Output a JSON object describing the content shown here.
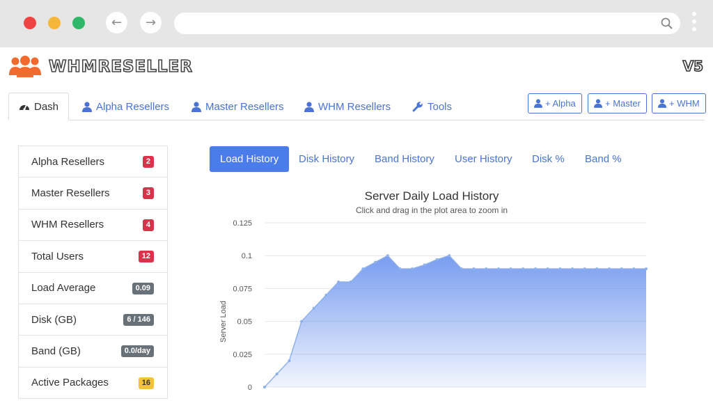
{
  "brand": {
    "name": "WHMRESELLER",
    "version": "V5"
  },
  "main_tabs": [
    {
      "label": "Dash",
      "icon": "dashboard-icon"
    },
    {
      "label": "Alpha Resellers",
      "icon": "user-icon"
    },
    {
      "label": "Master Resellers",
      "icon": "user-icon"
    },
    {
      "label": "WHM Resellers",
      "icon": "user-icon"
    },
    {
      "label": "Tools",
      "icon": "wrench-icon"
    }
  ],
  "add_buttons": [
    {
      "label": "+ Alpha"
    },
    {
      "label": "+ Master"
    },
    {
      "label": "+ WHM"
    }
  ],
  "stats": [
    {
      "label": "Alpha Resellers",
      "value": "2",
      "color": "#d9334b"
    },
    {
      "label": "Master Resellers",
      "value": "3",
      "color": "#d9334b"
    },
    {
      "label": "WHM Resellers",
      "value": "4",
      "color": "#d9334b"
    },
    {
      "label": "Total Users",
      "value": "12",
      "color": "#d9334b"
    },
    {
      "label": "Load Average",
      "value": "0.09",
      "color": "#687078"
    },
    {
      "label": "Disk (GB)",
      "value": "6 / 146",
      "color": "#687078"
    },
    {
      "label": "Band (GB)",
      "value": "0.0/day",
      "color": "#687078"
    },
    {
      "label": "Active Packages",
      "value": "16",
      "color": "#f5c33b"
    }
  ],
  "chart_tabs": [
    "Load History",
    "Disk History",
    "Band History",
    "User History",
    "Disk %",
    "Band %"
  ],
  "chart_data": {
    "type": "area",
    "title": "Server Daily Load History",
    "subtitle": "Click and drag in the plot area to zoom in",
    "ylabel": "Server Load",
    "xlabel": "",
    "ylim": [
      0,
      0.125
    ],
    "yticks": [
      "0",
      "0.025",
      "0.05",
      "0.075",
      "0.1",
      "0.125"
    ],
    "grid": true,
    "color": "#4b7ceb",
    "series": [
      {
        "values": [
          0,
          0.01,
          0.02,
          0.05,
          0.06,
          0.07,
          0.08,
          0.08,
          0.09,
          0.095,
          0.1,
          0.09,
          0.09,
          0.093,
          0.097,
          0.1,
          0.09,
          0.09,
          0.09,
          0.09,
          0.09,
          0.09,
          0.09,
          0.09,
          0.09,
          0.09,
          0.09,
          0.09,
          0.09,
          0.09,
          0.09,
          0.09
        ]
      }
    ]
  }
}
